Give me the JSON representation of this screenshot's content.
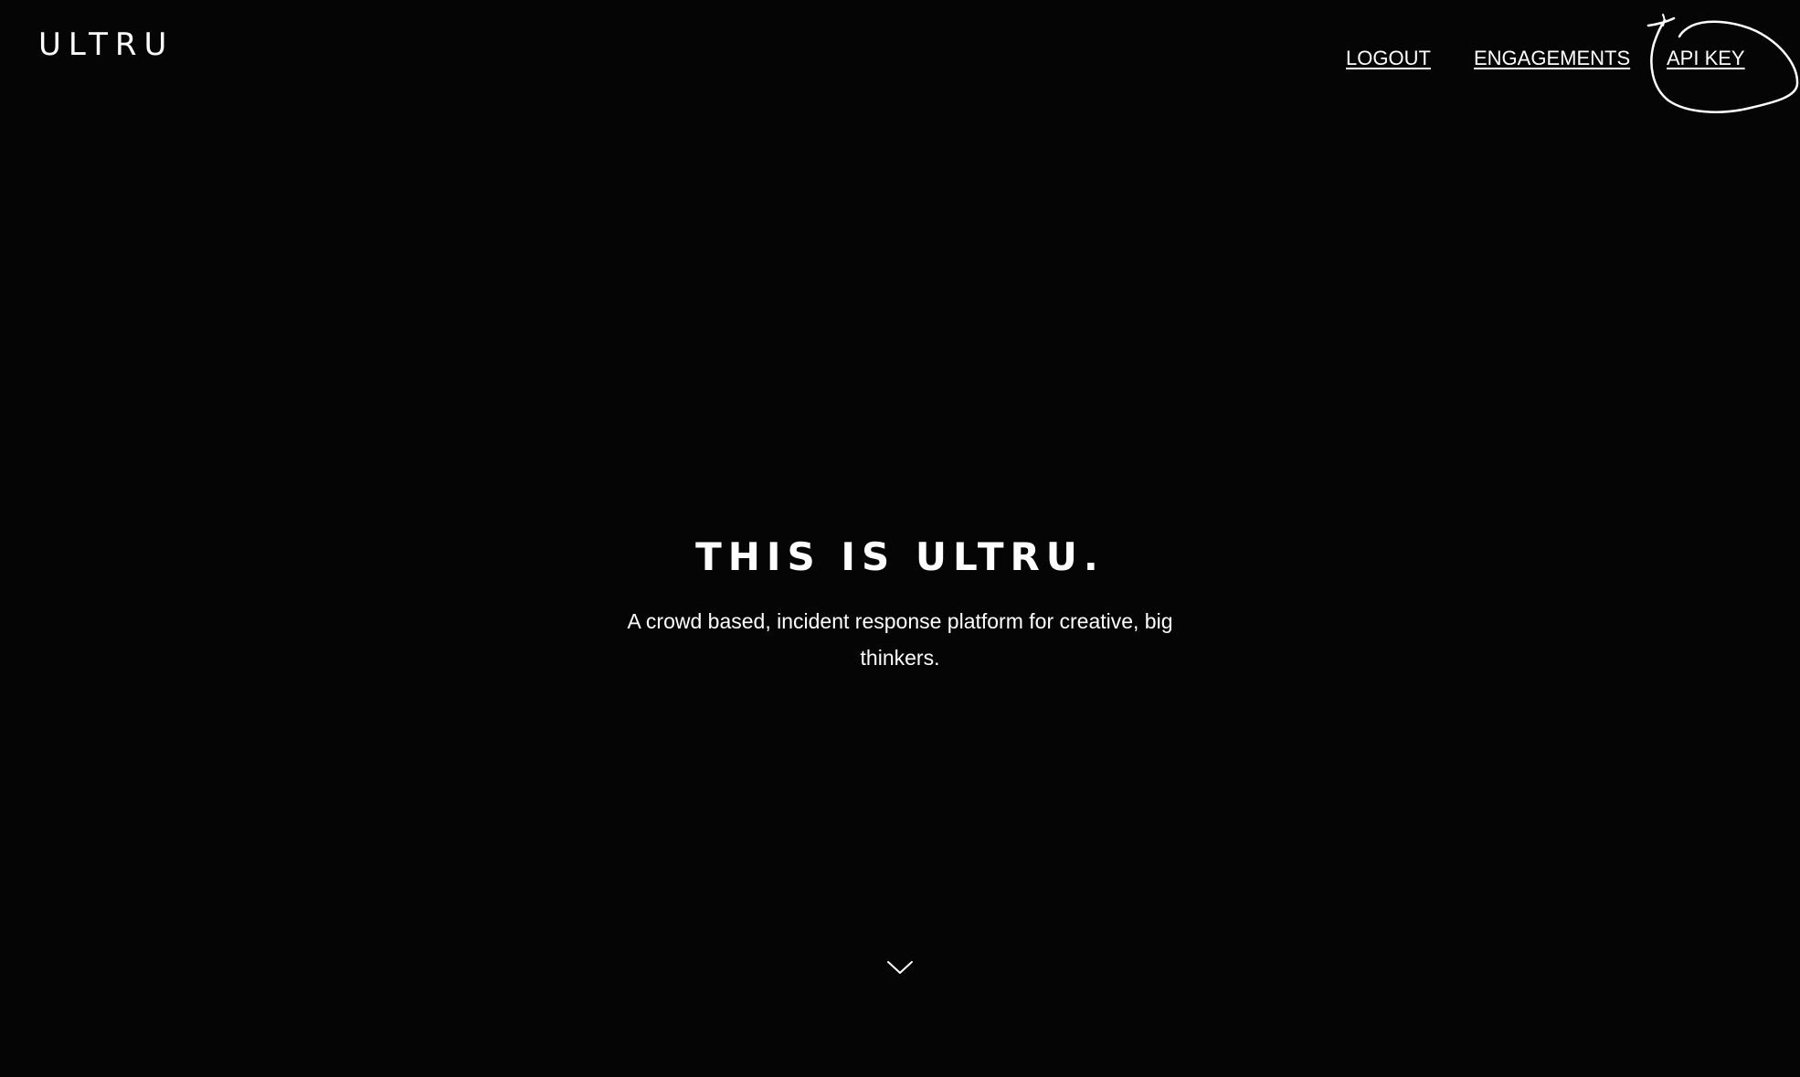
{
  "header": {
    "logo": "ULTRU",
    "nav": {
      "logout": "LOGOUT",
      "engagements": "ENGAGEMENTS",
      "api_key": "API KEY"
    }
  },
  "hero": {
    "title": "THIS IS ULTRU.",
    "subtitle": "A crowd based, incident response platform for creative, big thinkers."
  },
  "icons": {
    "scroll_down": "chevron-down-icon",
    "annotation": "hand-drawn-circle"
  },
  "colors": {
    "background": "#050505",
    "text": "#ffffff"
  }
}
